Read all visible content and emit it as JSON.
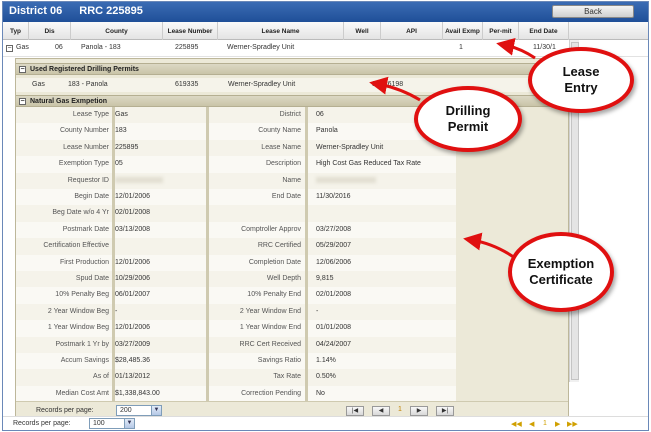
{
  "title": {
    "district": "District 06",
    "rrc": "RRC 225895"
  },
  "back_label": "Back",
  "columns": [
    "Typ",
    "Dis",
    "County",
    "Lease Number",
    "Lease Name",
    "Well",
    "API",
    "Avail Exmp",
    "Per-mit",
    "End Date"
  ],
  "lease_row": {
    "typ": "Gas",
    "dis": "06",
    "county": "Panola - 183",
    "lease_number": "225895",
    "lease_name": "Werner-Spradley Unit",
    "avail": "1",
    "end_date": "11/30/1"
  },
  "permits_header": "Used Registered Drilling Permits",
  "permit_row": {
    "typ": "Gas",
    "county": "183 - Panola",
    "number": "619335",
    "name": "Werner-Spradley Unit",
    "api": "36536198"
  },
  "exemption_header": "Natural Gas Exmpetion",
  "details": [
    {
      "l1": "Lease Type",
      "v1": "Gas",
      "l2": "District",
      "v2": "06"
    },
    {
      "l1": "County Number",
      "v1": "183",
      "l2": "County Name",
      "v2": "Panola"
    },
    {
      "l1": "Lease Number",
      "v1": "225895",
      "l2": "Lease Name",
      "v2": "Werner-Spradley Unit"
    },
    {
      "l1": "Exemption Type",
      "v1": "05",
      "l2": "Description",
      "v2": "High Cost Gas Reduced Tax Rate"
    },
    {
      "l1": "Requestor ID",
      "v1": "",
      "l2": "Name",
      "v2": ""
    },
    {
      "l1": "Begin Date",
      "v1": "12/01/2006",
      "l2": "End Date",
      "v2": "11/30/2016"
    },
    {
      "l1": "Beg Date w/o 4 Yr",
      "v1": "02/01/2008",
      "l2": "",
      "v2": ""
    },
    {
      "l1": "Postmark Date",
      "v1": "03/13/2008",
      "l2": "Comptroller Approv",
      "v2": "03/27/2008"
    },
    {
      "l1": "Certification Effective",
      "v1": "",
      "l2": "RRC Certified",
      "v2": "05/29/2007"
    },
    {
      "l1": "First Production",
      "v1": "12/01/2006",
      "l2": "Completion Date",
      "v2": "12/06/2006"
    },
    {
      "l1": "Spud Date",
      "v1": "10/29/2006",
      "l2": "Well Depth",
      "v2": "9,815"
    },
    {
      "l1": "10% Penalty Beg",
      "v1": "06/01/2007",
      "l2": "10% Penalty End",
      "v2": "02/01/2008"
    },
    {
      "l1": "2 Year Window Beg",
      "v1": "-",
      "l2": "2 Year Window End",
      "v2": "-"
    },
    {
      "l1": "1 Year Window Beg",
      "v1": "12/01/2006",
      "l2": "1 Year Window End",
      "v2": "01/01/2008"
    },
    {
      "l1": "Postmark 1 Yr by",
      "v1": "03/27/2009",
      "l2": "RRC Cert Received",
      "v2": "04/24/2007"
    },
    {
      "l1": "Accum Savings",
      "v1": "$28,485.36",
      "l2": "Savings Ratio",
      "v2": "1.14%"
    },
    {
      "l1": "As of",
      "v1": "01/13/2012",
      "l2": "Tax Rate",
      "v2": "0.50%"
    },
    {
      "l1": "Median Cost Amt",
      "v1": "$1,338,843.00",
      "l2": "Correction Pending",
      "v2": "No"
    }
  ],
  "inner_pager": {
    "label": "Records per page:",
    "value": "200",
    "page": "1"
  },
  "outer_pager": {
    "label": "Records per page:",
    "value": "100",
    "page": "1"
  },
  "callouts": {
    "lease": "Lease Entry",
    "permit": "Drilling Permit",
    "exemption": "Exemption Certificate"
  },
  "colors": {
    "title_bar": "#1f4f98",
    "callout_border": "#e01010",
    "panel": "#ece9d8"
  }
}
